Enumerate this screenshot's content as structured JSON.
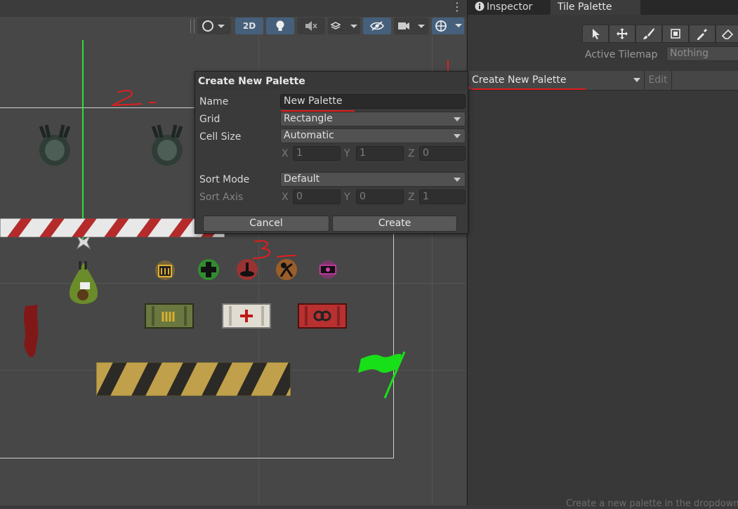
{
  "scene": {
    "toolbar": {
      "mode_2d_label": "2D",
      "kebab": "⋮"
    },
    "annotations": {
      "step1": "1",
      "step2": "2",
      "step3": "3"
    }
  },
  "panel": {
    "tabs": [
      {
        "label": "Inspector",
        "icon": "info-icon"
      },
      {
        "label": "Tile Palette"
      }
    ],
    "tools": [
      "select-arrow-icon",
      "move-icon",
      "brush-icon",
      "box-fill-icon",
      "picker-icon",
      "eraser-icon"
    ],
    "active_tilemap_label": "Active Tilemap",
    "active_tilemap_value": "Nothing",
    "palette_dropdown_label": "Create New Palette",
    "edit_label": "Edit",
    "bottom_hint": "Create a new palette in the dropdown above."
  },
  "dialog": {
    "title": "Create New Palette",
    "name_label": "Name",
    "name_value": "New Palette",
    "grid_label": "Grid",
    "grid_value": "Rectangle",
    "cell_size_label": "Cell Size",
    "cell_size_value": "Automatic",
    "cell_x_label": "X",
    "cell_x": "1",
    "cell_y_label": "Y",
    "cell_y": "1",
    "cell_z_label": "Z",
    "cell_z": "0",
    "sort_mode_label": "Sort Mode",
    "sort_mode_value": "Default",
    "sort_axis_label": "Sort Axis",
    "axis_x_label": "X",
    "axis_x": "0",
    "axis_y_label": "Y",
    "axis_y": "0",
    "axis_z_label": "Z",
    "axis_z": "1",
    "cancel_label": "Cancel",
    "create_label": "Create"
  },
  "colors": {
    "accent_blue": "#46607c",
    "annotation_red": "#e01e1e",
    "gizmo_green": "#33dd33"
  }
}
